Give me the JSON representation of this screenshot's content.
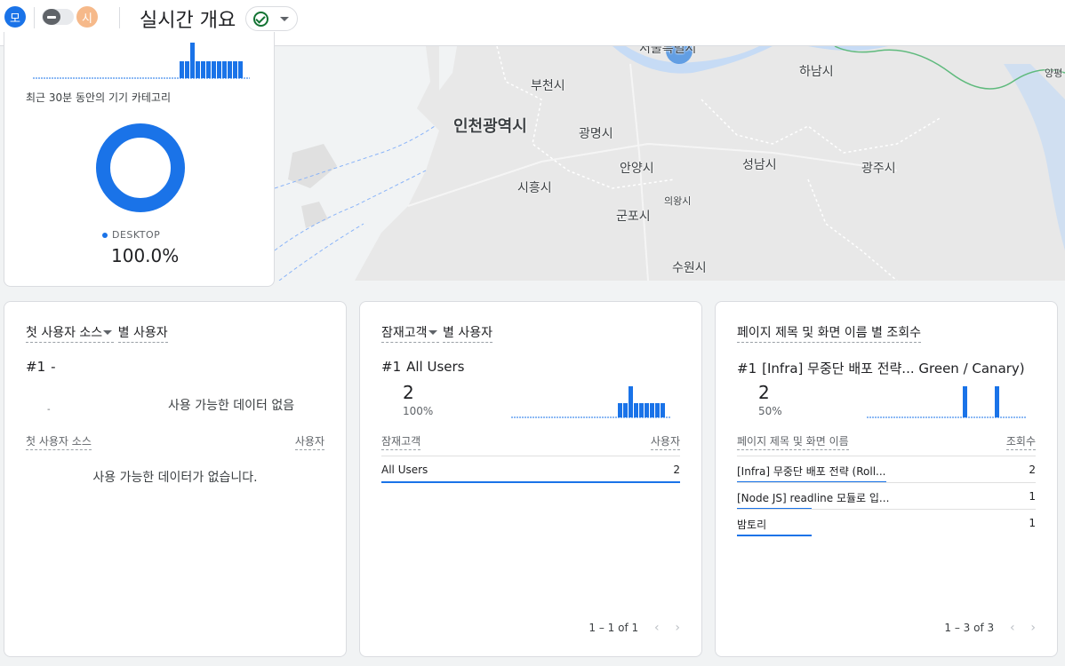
{
  "header": {
    "avatar1": "모",
    "avatar2": "시",
    "title": "실시간 개요"
  },
  "map": {
    "labels": [
      "서울특별시",
      "하남시",
      "양평",
      "부천시",
      "인천광역시",
      "광명시",
      "안양시",
      "성남시",
      "광주시",
      "시흥시",
      "의왕시",
      "군포시",
      "수원시"
    ]
  },
  "device": {
    "caption": "최근 30분 동안의 기기 카테고리",
    "legend_label": "DESKTOP",
    "legend_value": "100.0%",
    "share": 100,
    "color": "#1a73e8"
  },
  "first_source_card": {
    "title_part1": "첫 사용자 소스",
    "title_part2": "별 사용자",
    "rank": "#1",
    "rank_value": "-",
    "small_dash": "-",
    "no_data": "사용 가능한 데이터 없음",
    "col_left": "첫 사용자 소스",
    "col_right": "사용자",
    "table_empty": "사용 가능한 데이터가 없습니다."
  },
  "audience_card": {
    "title_part1": "잠재고객",
    "title_part2": "별 사용자",
    "rank": "#1",
    "rank_value": "All Users",
    "big_number": "2",
    "percent": "100%",
    "col_left": "잠재고객",
    "col_right": "사용자",
    "rows": [
      {
        "label": "All Users",
        "value": "2",
        "share": 1.0
      }
    ],
    "pager": "1 – 1 of 1"
  },
  "page_title_card": {
    "title": "페이지 제목 및 화면 이름 별 조회수",
    "rank": "#1",
    "rank_value": "[Infra] 무중단 배포 전략... Green / Canary)",
    "big_number": "2",
    "percent": "50%",
    "col_left": "페이지 제목 및 화면 이름",
    "col_right": "조회수",
    "rows": [
      {
        "label": "[Infra] 무중단 배포 전략 (Roll...",
        "value": "2",
        "share": 0.5
      },
      {
        "label": "[Node JS] readline 모듈로 입...",
        "value": "1",
        "share": 0.25
      },
      {
        "label": "밤토리",
        "value": "1",
        "share": 0.25
      }
    ],
    "pager": "1 – 3 of 3"
  },
  "colors": {
    "accent": "#1a73e8",
    "map_water": "#c6dbf5",
    "map_land": "#e8e8e8"
  }
}
